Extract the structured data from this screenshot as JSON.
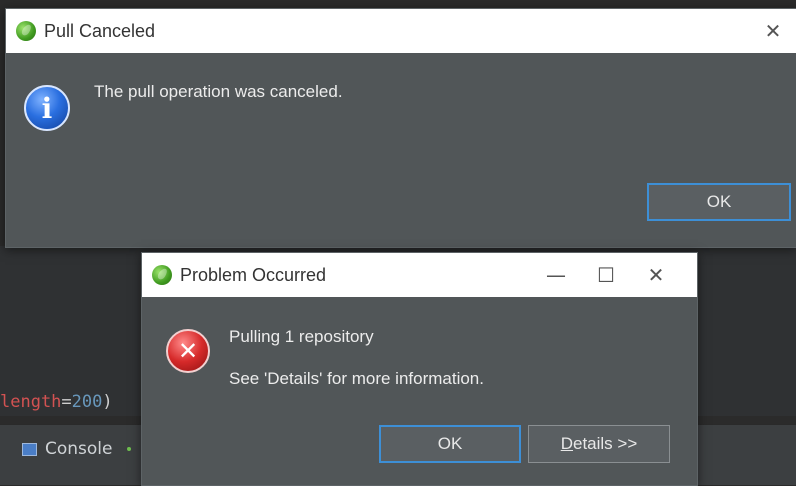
{
  "background": {
    "code_prefix": "length",
    "code_equals": "=",
    "code_number": "200",
    "code_suffix": ")",
    "console_tab_label": "Console"
  },
  "pull_canceled_dialog": {
    "title": "Pull Canceled",
    "icon": "info-icon",
    "message": "The pull operation was canceled.",
    "ok_label": "OK",
    "close_glyph": "✕"
  },
  "problem_dialog": {
    "title": "Problem Occurred",
    "icon": "error-icon",
    "message_line1": "Pulling 1 repository",
    "message_line2": "See 'Details' for more information.",
    "ok_label": "OK",
    "details_first": "D",
    "details_rest": "etails >>",
    "minimize_glyph": "—",
    "maximize_glyph": "☐",
    "close_glyph": "✕"
  },
  "colors": {
    "dialog_bg": "#515658",
    "default_button_border": "#3d8fd6",
    "titlebar_bg": "#ffffff"
  }
}
